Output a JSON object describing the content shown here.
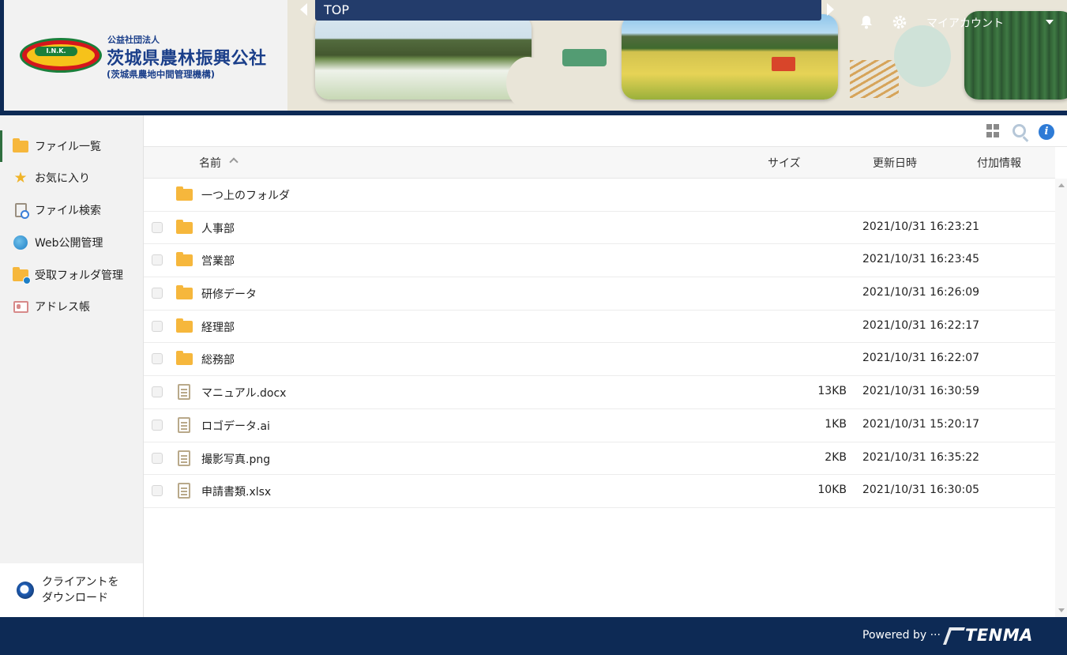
{
  "header": {
    "logo_mark": "I.N.K.",
    "org_small": "公益社団法人",
    "org_name": "茨城県農林振興公社",
    "org_sub": "(茨城県農地中間管理機構)",
    "breadcrumb": "TOP",
    "account_label": "マイアカウント",
    "icons": {
      "notification": "bell-icon",
      "settings": "gear-icon"
    }
  },
  "sidebar": {
    "items": [
      {
        "label": "ファイル一覧",
        "icon": "folder-icon",
        "active": true
      },
      {
        "label": "お気に入り",
        "icon": "star-icon"
      },
      {
        "label": "ファイル検索",
        "icon": "file-search-icon"
      },
      {
        "label": "Web公開管理",
        "icon": "globe-icon"
      },
      {
        "label": "受取フォルダ管理",
        "icon": "folder-globe-icon"
      },
      {
        "label": "アドレス帳",
        "icon": "address-book-icon"
      }
    ],
    "client_download": {
      "line1": "クライアントを",
      "line2": "ダウンロード"
    }
  },
  "toolbar": {
    "icons": [
      "grid-view-icon",
      "search-icon",
      "info-icon"
    ],
    "info_glyph": "i"
  },
  "table": {
    "columns": {
      "name": "名前",
      "size": "サイズ",
      "updated": "更新日時",
      "extra": "付加情報"
    },
    "sort": {
      "column": "name",
      "direction": "asc"
    },
    "parent_folder": "一つ上のフォルダ",
    "rows": [
      {
        "name": "人事部",
        "type": "folder",
        "size": "",
        "updated": "2021/10/31 16:23:21"
      },
      {
        "name": "営業部",
        "type": "folder",
        "size": "",
        "updated": "2021/10/31 16:23:45"
      },
      {
        "name": "研修データ",
        "type": "folder",
        "size": "",
        "updated": "2021/10/31 16:26:09"
      },
      {
        "name": "経理部",
        "type": "folder",
        "size": "",
        "updated": "2021/10/31 16:22:17"
      },
      {
        "name": "総務部",
        "type": "folder",
        "size": "",
        "updated": "2021/10/31 16:22:07"
      },
      {
        "name": "マニュアル.docx",
        "type": "file",
        "size": "13KB",
        "updated": "2021/10/31 16:30:59"
      },
      {
        "name": "ロゴデータ.ai",
        "type": "file",
        "size": "1KB",
        "updated": "2021/10/31 15:20:17"
      },
      {
        "name": "撮影写真.png",
        "type": "file",
        "size": "2KB",
        "updated": "2021/10/31 16:35:22"
      },
      {
        "name": "申請書類.xlsx",
        "type": "file",
        "size": "10KB",
        "updated": "2021/10/31 16:30:05"
      }
    ]
  },
  "footer": {
    "powered_by": "Powered by ···",
    "brand": "TENMA"
  },
  "colors": {
    "navy": "#0d2a55",
    "folder": "#f6b73c",
    "active_marker": "#2f6f3f",
    "info_blue": "#2e7bd6"
  }
}
